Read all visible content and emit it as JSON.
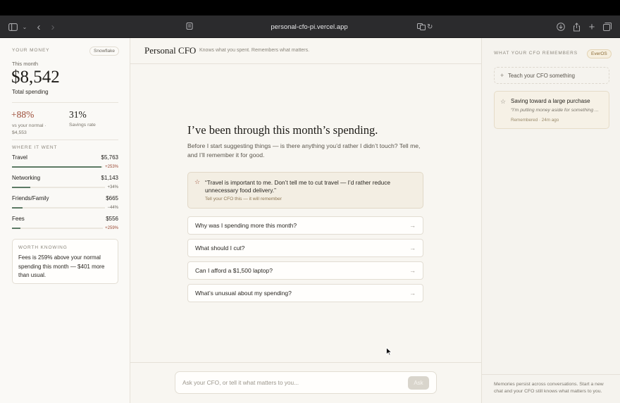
{
  "browser": {
    "url": "personal-cfo-pi.vercel.app"
  },
  "sidebar": {
    "title": "YOUR MONEY",
    "badge": "Snowflake",
    "period": "This month",
    "total": "$8,542",
    "total_label": "Total spending",
    "change_value": "+88%",
    "change_label_line1": "vs your normal ·",
    "change_label_line2": "$4,553",
    "savings_value": "31%",
    "savings_label": "Savings rate",
    "breakdown_title": "WHERE IT WENT",
    "categories": [
      {
        "name": "Travel",
        "amount": "$5,763",
        "change": "+253%",
        "fill": 0.84
      },
      {
        "name": "Networking",
        "amount": "$1,143",
        "change": "+34%",
        "fill": 0.17
      },
      {
        "name": "Friends/Family",
        "amount": "$665",
        "change": "−44%",
        "fill": 0.1
      },
      {
        "name": "Fees",
        "amount": "$556",
        "change": "+259%",
        "fill": 0.08
      }
    ],
    "insight_title": "WORTH KNOWING",
    "insight_text": "Fees is 259% above your normal spending this month — $401 more than usual."
  },
  "header": {
    "title": "Personal CFO",
    "subtitle": "Knows what you spent. Remembers what matters."
  },
  "main": {
    "heading": "I’ve been through this month’s spending.",
    "intro": "Before I start suggesting things — is there anything you’d rather I didn’t touch? Tell me, and I’ll remember it for good.",
    "suggestion_quote": "“Travel is important to me. Don’t tell me to cut travel — I’d rather reduce unnecessary food delivery.”",
    "suggestion_hint": "Tell your CFO this — it will remember",
    "questions": [
      "Why was I spending more this month?",
      "What should I cut?",
      "Can I afford a $1,500 laptop?",
      "What’s unusual about my spending?"
    ],
    "input_placeholder": "Ask your CFO, or tell it what matters to you...",
    "ask_label": "Ask"
  },
  "memory": {
    "title": "WHAT YOUR CFO REMEMBERS",
    "badge": "EverOS",
    "teach_label": "Teach your CFO something",
    "items": [
      {
        "title": "Saving toward a large purchase",
        "quote": "“I’m putting money aside for something ...",
        "meta": "Remembered · 24m ago"
      }
    ],
    "footer": "Memories persist across conversations. Start a new chat and your CFO still knows what matters to you."
  },
  "colors": {
    "accent_red": "#9b4a35",
    "bar_green": "#5c7a64",
    "suggestion_bg": "#f3eee3",
    "ask_button": "#d9d5cc"
  }
}
